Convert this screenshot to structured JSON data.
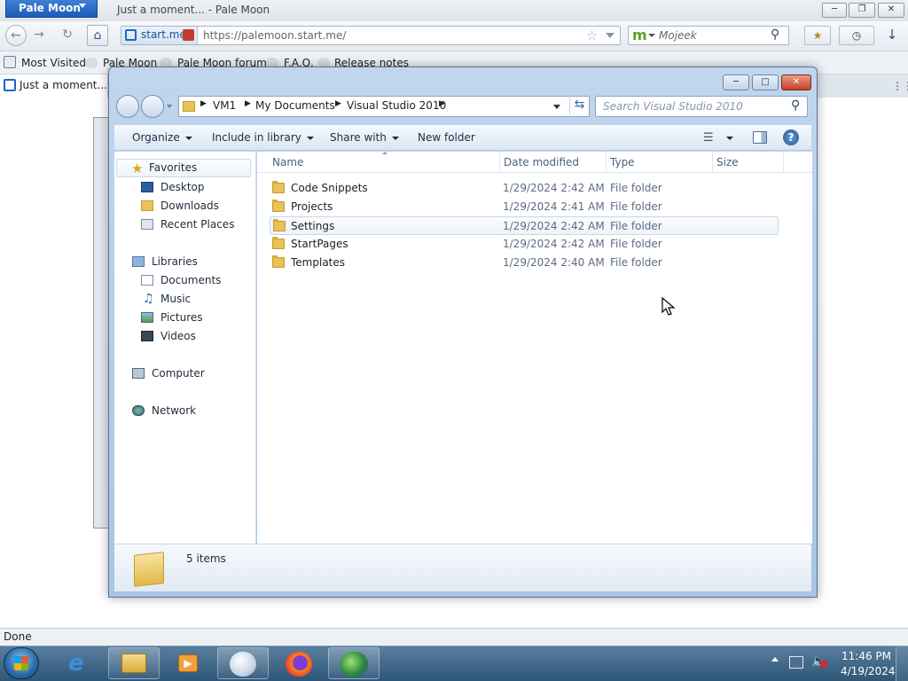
{
  "browser": {
    "menu_label": "Pale Moon",
    "window_title": "Just a moment... - Pale Moon",
    "identity": "start.me",
    "url": "https://palemoon.start.me/",
    "search_engine": "Mojeek",
    "bookmarks": [
      "Most Visited",
      "Pale Moon",
      "Pale Moon forum",
      "F.A.Q.",
      "Release notes"
    ],
    "tab_title": "Just a moment...",
    "status": "Done"
  },
  "explorer": {
    "breadcrumb": [
      "VM1",
      "My Documents",
      "Visual Studio 2010"
    ],
    "search_placeholder": "Search Visual Studio 2010",
    "toolbar": {
      "organize": "Organize",
      "include": "Include in library",
      "share": "Share with",
      "new_folder": "New folder"
    },
    "nav": {
      "favorites": "Favorites",
      "favorites_items": [
        "Desktop",
        "Downloads",
        "Recent Places"
      ],
      "libraries": "Libraries",
      "libraries_items": [
        "Documents",
        "Music",
        "Pictures",
        "Videos"
      ],
      "computer": "Computer",
      "network": "Network"
    },
    "columns": [
      "Name",
      "Date modified",
      "Type",
      "Size"
    ],
    "files": [
      {
        "name": "Code Snippets",
        "date": "1/29/2024 2:42 AM",
        "type": "File folder"
      },
      {
        "name": "Projects",
        "date": "1/29/2024 2:41 AM",
        "type": "File folder"
      },
      {
        "name": "Settings",
        "date": "1/29/2024 2:42 AM",
        "type": "File folder"
      },
      {
        "name": "StartPages",
        "date": "1/29/2024 2:42 AM",
        "type": "File folder"
      },
      {
        "name": "Templates",
        "date": "1/29/2024 2:40 AM",
        "type": "File folder"
      }
    ],
    "selected_row": 2,
    "item_count": "5 items"
  },
  "taskbar": {
    "time": "11:46 PM",
    "date": "4/19/2024"
  },
  "colors": {
    "accent": "#1d5cb6",
    "selection": "#eef3fa",
    "taskbar": "#2e5778"
  }
}
